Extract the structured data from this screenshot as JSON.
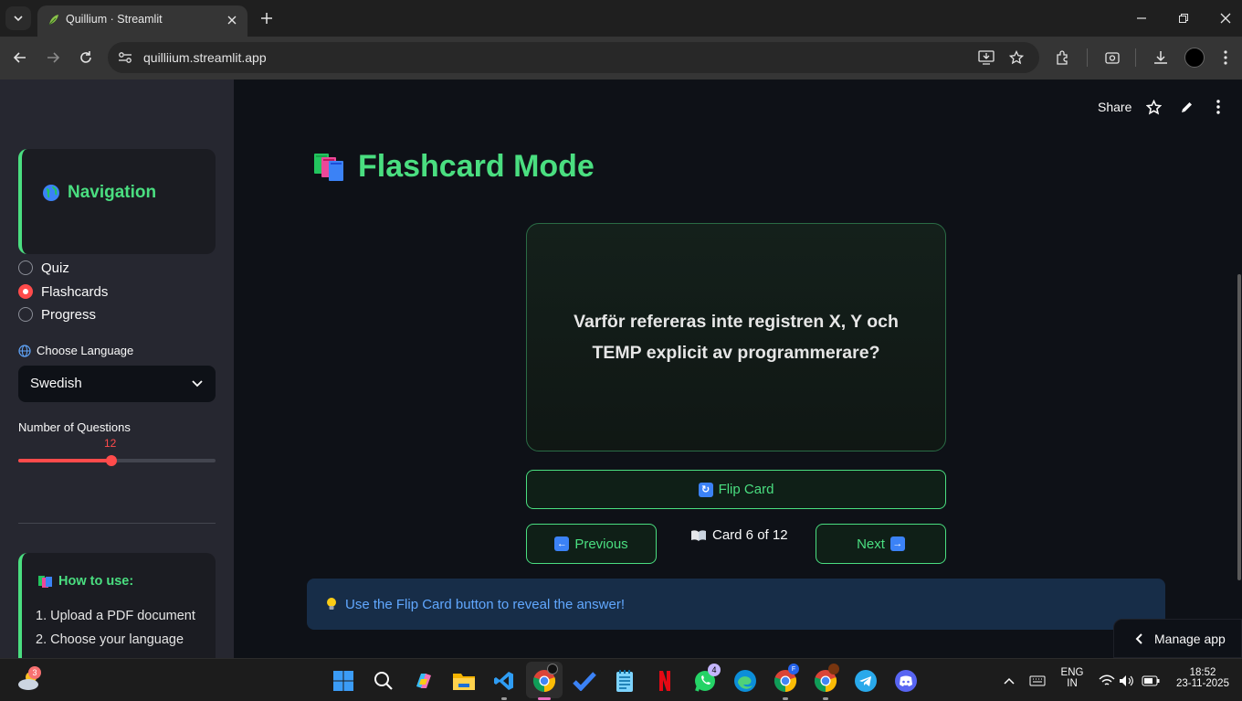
{
  "browser": {
    "tab_title": "Quillium · Streamlit",
    "url": "quilliium.streamlit.app"
  },
  "sidebar": {
    "nav_title": "Navigation",
    "nav_items": [
      {
        "label": "Quiz",
        "selected": false
      },
      {
        "label": "Flashcards",
        "selected": true
      },
      {
        "label": "Progress",
        "selected": false
      }
    ],
    "language_label": "Choose Language",
    "language_value": "Swedish",
    "questions_label": "Number of Questions",
    "questions_value": "12",
    "questions_fraction": 0.47,
    "howto_title": "How to use:",
    "howto_items": [
      "1. Upload a PDF document",
      "2. Choose your language"
    ]
  },
  "header": {
    "share_label": "Share"
  },
  "main": {
    "title": "Flashcard Mode",
    "card_text": "Varför refereras inte registren X, Y och TEMP explicit av programmerare?",
    "flip_label": "Flip Card",
    "prev_label": "Previous",
    "next_label": "Next",
    "counter": "Card 6 of 12",
    "info": "Use the Flip Card button to reveal the answer!",
    "manage_app": "Manage app"
  },
  "taskbar": {
    "weather_badge": "3",
    "whatsapp_badge": "4",
    "lang_line1": "ENG",
    "lang_line2": "IN",
    "time": "18:52",
    "date": "23-11-2025"
  },
  "colors": {
    "accent_green": "#4ade80",
    "streamlit_red": "#ff4b4b",
    "info_blue": "#61a8ff"
  }
}
